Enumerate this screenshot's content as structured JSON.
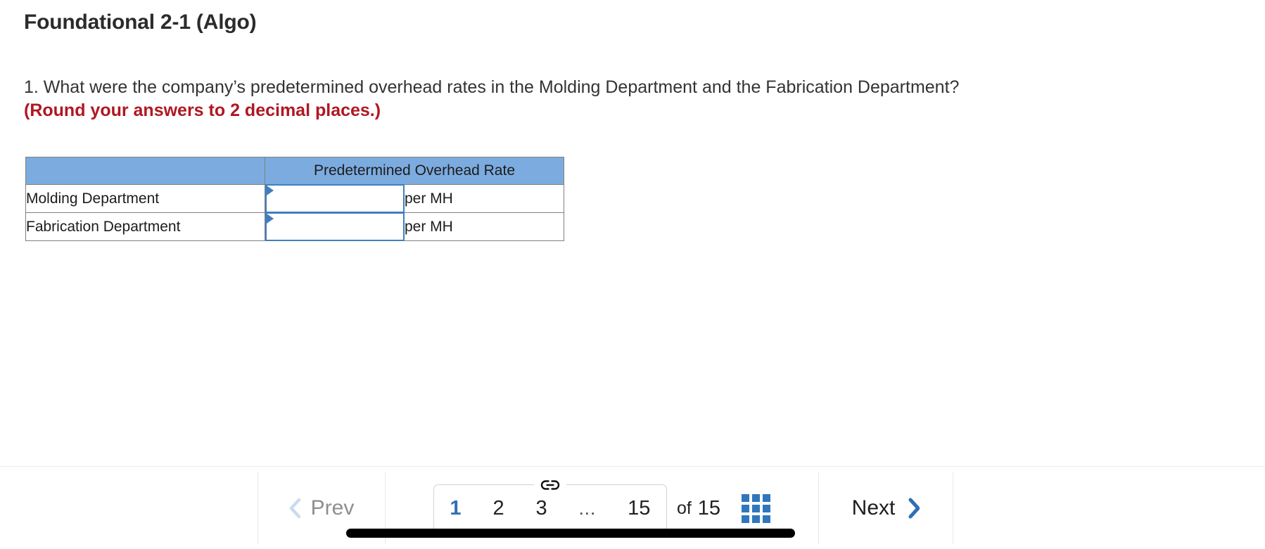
{
  "question": {
    "title": "Foundational 2-1 (Algo)",
    "prompt": "1. What were the company’s predetermined overhead rates in the Molding Department and the Fabrication Department?",
    "round_note": "(Round your answers to 2 decimal places.)"
  },
  "answer_table": {
    "headers": [
      "",
      "Predetermined Overhead Rate"
    ],
    "rows": [
      {
        "label": "Molding Department",
        "value": "",
        "unit": "per MH"
      },
      {
        "label": "Fabrication Department",
        "value": "",
        "unit": "per MH"
      }
    ],
    "header_bg": "#7cabdf",
    "input_border": "#3f7fc1",
    "grid_border": "#808080"
  },
  "footer": {
    "prev_label": "Prev",
    "next_label": "Next",
    "of_label": "of",
    "total_pages": "15",
    "pages": [
      {
        "label": "1",
        "active": true
      },
      {
        "label": "2",
        "active": false
      },
      {
        "label": "3",
        "active": false
      },
      {
        "label": "...",
        "active": false
      },
      {
        "label": "15",
        "active": false
      }
    ],
    "icons": {
      "link": "link-icon",
      "grid": "grid-icon",
      "prev_chevron": "chevron-left-icon",
      "next_chevron": "chevron-right-icon"
    },
    "colors": {
      "active_page": "#2f6fb5",
      "prev_disabled": "#8e8e8e",
      "prev_chevron": "#c8dcef",
      "next_chevron": "#2f6fb5",
      "grid": "#3076bd"
    }
  }
}
